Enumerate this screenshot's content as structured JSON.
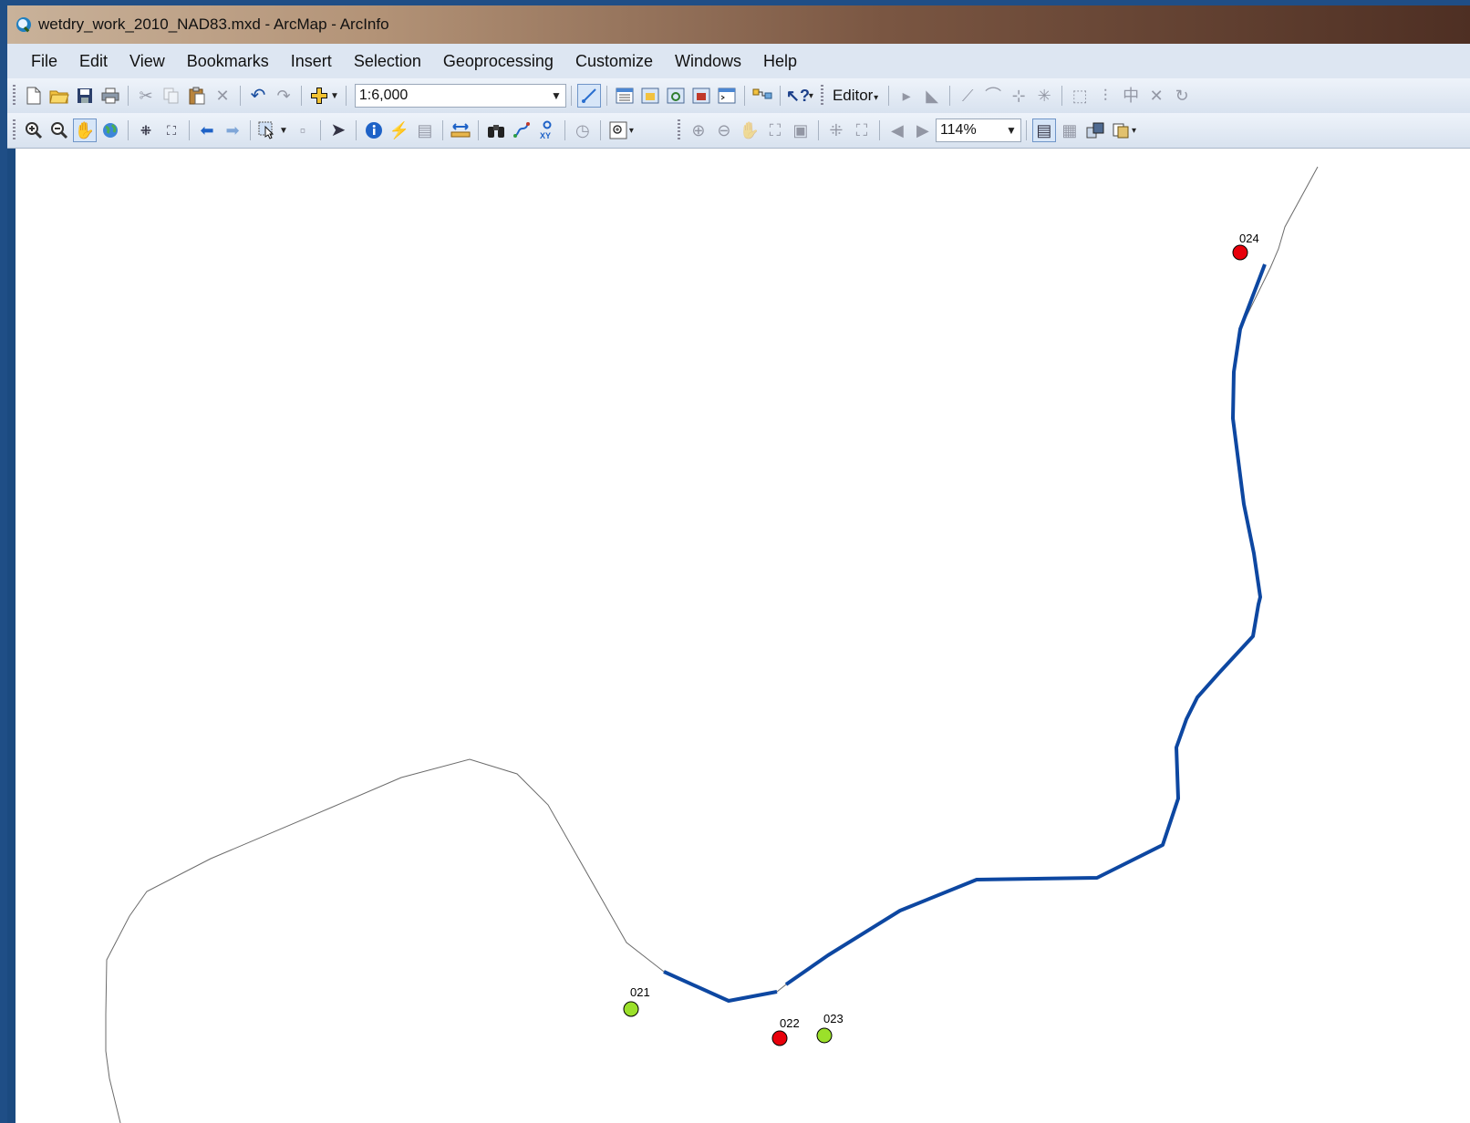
{
  "window": {
    "title": "wetdry_work_2010_NAD83.mxd - ArcMap - ArcInfo"
  },
  "menu": [
    "File",
    "Edit",
    "View",
    "Bookmarks",
    "Insert",
    "Selection",
    "Geoprocessing",
    "Customize",
    "Windows",
    "Help"
  ],
  "standard_toolbar": {
    "scale": "1:6,000",
    "editor_label": "Editor"
  },
  "layout_toolbar": {
    "zoom_percent": "114%"
  },
  "icons": {
    "new": "new-document-icon",
    "open": "open-folder-icon",
    "save": "save-icon",
    "print": "print-icon",
    "cut": "cut-icon",
    "copy": "copy-icon",
    "paste": "paste-icon",
    "delete": "delete-icon",
    "undo": "undo-icon",
    "redo": "redo-icon",
    "add_data": "add-data-icon",
    "zoom_in": "zoom-in-icon",
    "zoom_out": "zoom-out-icon",
    "pan": "pan-hand-icon",
    "full_extent": "globe-icon",
    "identify": "identify-icon",
    "find": "binoculars-icon",
    "go_to_xy": "go-to-xy-icon"
  },
  "map": {
    "point_labels": [
      "024",
      "021",
      "022",
      "023"
    ],
    "point_colors": {
      "red": "#e8000b",
      "green": "#9be02a"
    },
    "highlight_line_color": "#0d47a1",
    "base_line_color": "#6b6b6b"
  }
}
